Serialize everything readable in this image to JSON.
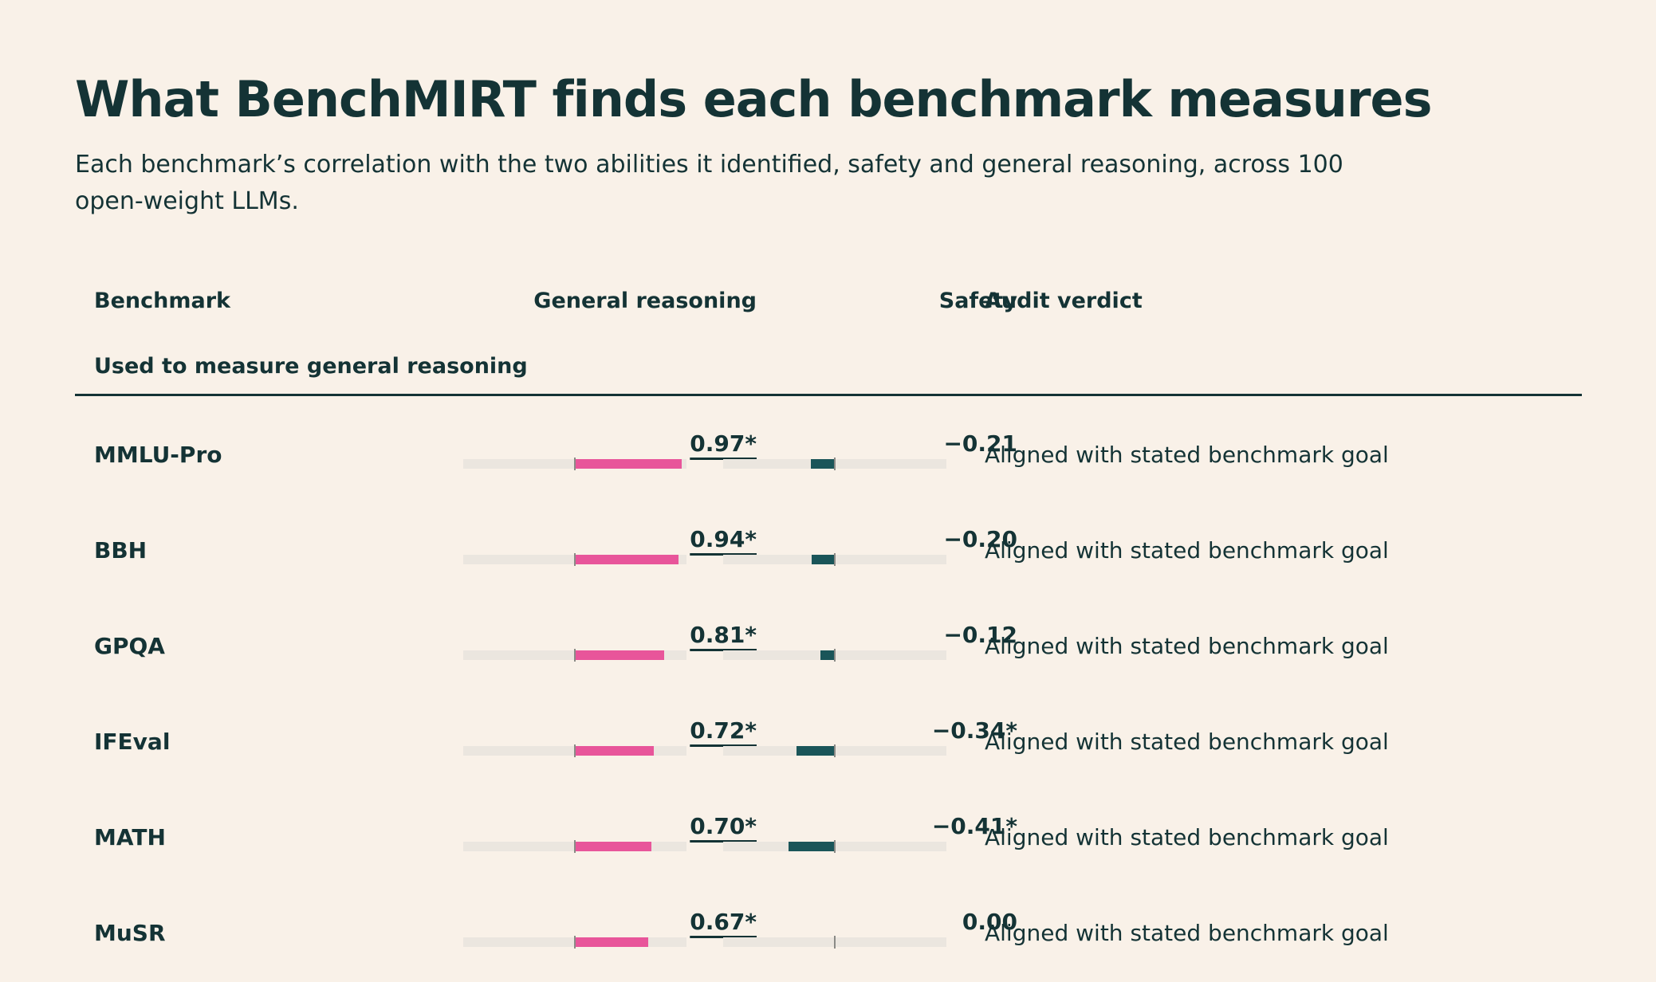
{
  "title": "What BenchMIRT finds each benchmark measures",
  "subtitle": "Each benchmark’s correlation with the two abilities it identified, safety and general reasoning, across 100 open-weight LLMs.",
  "columns": {
    "benchmark": "Benchmark",
    "general": "General reasoning",
    "safety": "Safety",
    "verdict": "Audit verdict"
  },
  "group_label": "Used to measure general reasoning",
  "colors": {
    "positive": "#e8559a",
    "negative": "#1a5559",
    "text": "#143335",
    "background": "#f9f1e8"
  },
  "chart_data": {
    "type": "table",
    "xlim": [
      -1,
      1
    ],
    "rows": [
      {
        "benchmark": "MMLU-Pro",
        "general": 0.97,
        "general_label": "0.97*",
        "general_sig": true,
        "safety": -0.21,
        "safety_label": "−0.21",
        "safety_sig": false,
        "verdict": "Aligned with stated benchmark goal"
      },
      {
        "benchmark": "BBH",
        "general": 0.94,
        "general_label": "0.94*",
        "general_sig": true,
        "safety": -0.2,
        "safety_label": "−0.20",
        "safety_sig": false,
        "verdict": "Aligned with stated benchmark goal"
      },
      {
        "benchmark": "GPQA",
        "general": 0.81,
        "general_label": "0.81*",
        "general_sig": true,
        "safety": -0.12,
        "safety_label": "−0.12",
        "safety_sig": false,
        "verdict": "Aligned with stated benchmark goal"
      },
      {
        "benchmark": "IFEval",
        "general": 0.72,
        "general_label": "0.72*",
        "general_sig": true,
        "safety": -0.34,
        "safety_label": "−0.34*",
        "safety_sig": false,
        "verdict": "Aligned with stated benchmark goal"
      },
      {
        "benchmark": "MATH",
        "general": 0.7,
        "general_label": "0.70*",
        "general_sig": true,
        "safety": -0.41,
        "safety_label": "−0.41*",
        "safety_sig": false,
        "verdict": "Aligned with stated benchmark goal"
      },
      {
        "benchmark": "MuSR",
        "general": 0.67,
        "general_label": "0.67*",
        "general_sig": true,
        "safety": 0.0,
        "safety_label": "0.00",
        "safety_sig": false,
        "verdict": "Aligned with stated benchmark goal"
      }
    ]
  }
}
